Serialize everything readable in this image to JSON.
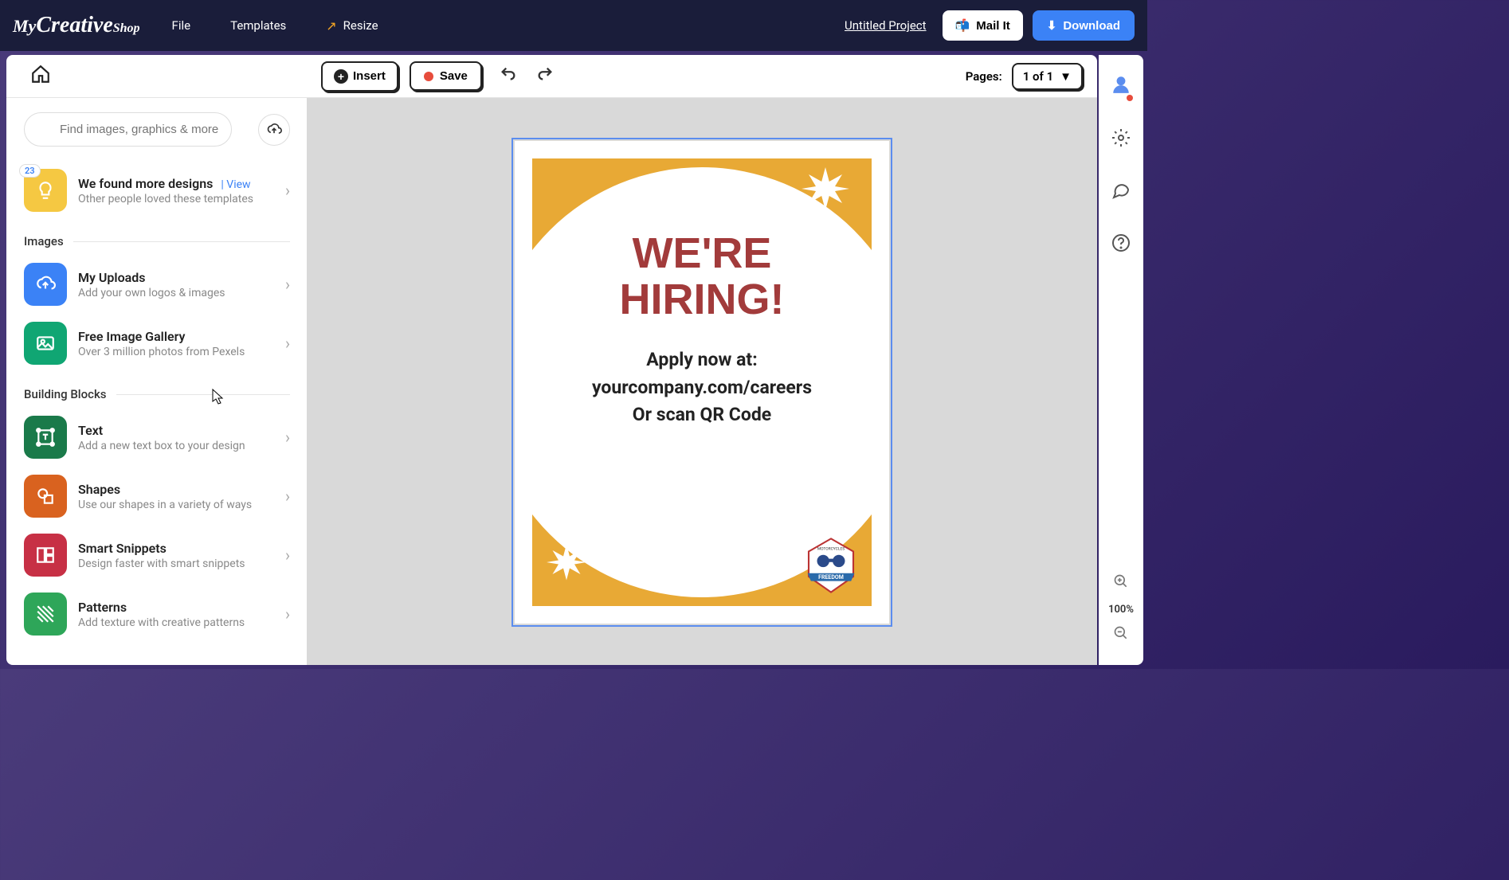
{
  "header": {
    "logo": "MyCreativeShop",
    "menu": {
      "file": "File",
      "templates": "Templates",
      "resize": "Resize"
    },
    "project": "Untitled Project",
    "mail": "Mail It",
    "download": "Download"
  },
  "search": {
    "placeholder": "Find images, graphics & more"
  },
  "sidebar": {
    "designs": {
      "badge": "23",
      "title": "We found more designs",
      "view": "| View",
      "sub": "Other people loved these templates"
    },
    "sections": {
      "images": "Images",
      "blocks": "Building Blocks"
    },
    "items": {
      "uploads": {
        "title": "My Uploads",
        "sub": "Add your own logos & images"
      },
      "gallery": {
        "title": "Free Image Gallery",
        "sub": "Over 3 million photos from Pexels"
      },
      "text": {
        "title": "Text",
        "sub": "Add a new text box to your design"
      },
      "shapes": {
        "title": "Shapes",
        "sub": "Use our shapes in a variety of ways"
      },
      "snippets": {
        "title": "Smart Snippets",
        "sub": "Design faster with smart snippets"
      },
      "patterns": {
        "title": "Patterns",
        "sub": "Add texture with creative patterns"
      }
    }
  },
  "toolbar": {
    "insert": "Insert",
    "save": "Save",
    "pages_label": "Pages:",
    "pages_value": "1 of 1"
  },
  "canvas": {
    "headline1": "WE'RE",
    "headline2": "HIRING!",
    "line1": "Apply now at:",
    "line2": "yourcompany.com/careers",
    "line3": "Or scan QR Code",
    "badge_top": "MOTORCYCLES",
    "badge_ribbon": "FREEDOM"
  },
  "zoom": {
    "level": "100%"
  }
}
